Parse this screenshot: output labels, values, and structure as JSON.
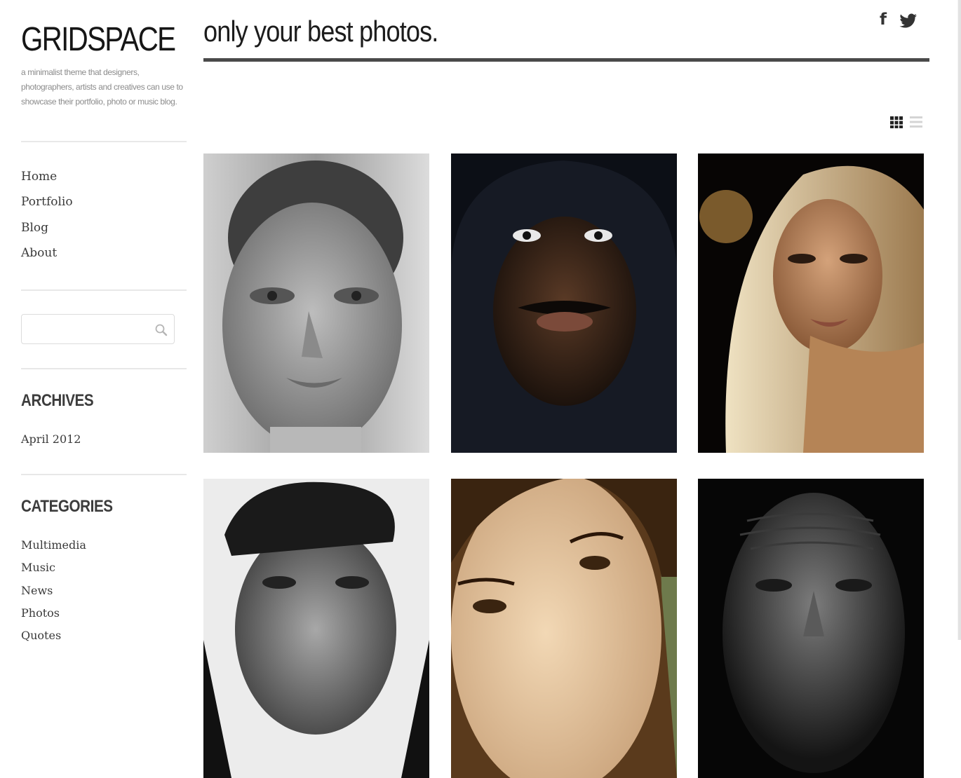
{
  "site": {
    "title": "GRIDSPACE",
    "tagline": "a minimalist theme that designers, photographers, artists and creatives can use to showcase their portfolio, photo or music blog."
  },
  "nav": {
    "items": [
      "Home",
      "Portfolio",
      "Blog",
      "About"
    ]
  },
  "search": {
    "placeholder": "",
    "value": "",
    "icon": "magnifier-icon"
  },
  "archives": {
    "title": "ARCHIVES",
    "items": [
      "April 2012"
    ]
  },
  "categories": {
    "title": "CATEGORIES",
    "items": [
      "Multimedia",
      "Music",
      "News",
      "Photos",
      "Quotes"
    ]
  },
  "header": {
    "headline": "only your best photos.",
    "social": [
      {
        "icon": "facebook-icon",
        "glyph": "f"
      },
      {
        "icon": "twitter-icon",
        "glyph": ""
      }
    ]
  },
  "view_toggle": {
    "grid_icon": "grid-view-icon",
    "list_icon": "list-view-icon",
    "active": "grid"
  },
  "photos": [
    {
      "icon": "portrait-woman-freckles",
      "tone": "grayscale"
    },
    {
      "icon": "portrait-man-hood",
      "tone": "dark"
    },
    {
      "icon": "portrait-woman-blonde",
      "tone": "warm"
    },
    {
      "icon": "portrait-man-cap",
      "tone": "grayscale"
    },
    {
      "icon": "portrait-woman-brunette",
      "tone": "sepia"
    },
    {
      "icon": "portrait-old-man",
      "tone": "dark-grayscale"
    }
  ],
  "colors": {
    "text": "#333333",
    "heading": "#1c1c1c",
    "muted": "#8c8c8c",
    "rule": "#4a4a4a"
  }
}
